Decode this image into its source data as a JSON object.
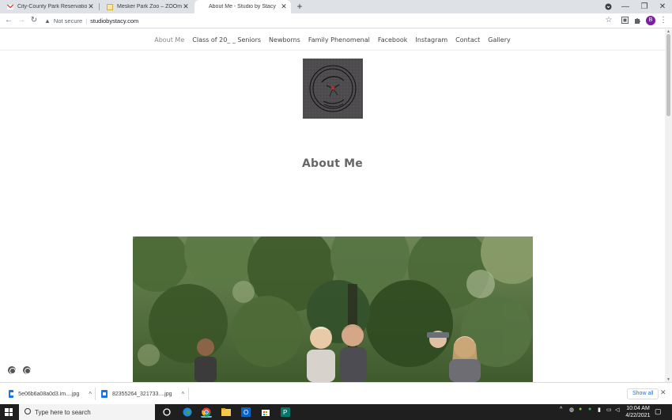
{
  "browser": {
    "tabs": [
      {
        "title": "City-County Park Reservations - E",
        "active": false,
        "favicon": "gmail-icon"
      },
      {
        "title": "Mesker Park Zoo – ZOOm a ZOO",
        "active": false,
        "favicon": "page-icon"
      },
      {
        "title": "About Me - Studio by Stacy",
        "active": true,
        "favicon": "none"
      }
    ],
    "address": {
      "security": "Not secure",
      "url": "studiobystacy.com"
    },
    "profile_initial": "B"
  },
  "site": {
    "nav": [
      {
        "label": "About Me",
        "active": true
      },
      {
        "label": "Class of 20_ _ Seniors",
        "active": false
      },
      {
        "label": "Newborns",
        "active": false
      },
      {
        "label": "Family Phenomenal",
        "active": false
      },
      {
        "label": "Facebook",
        "active": false
      },
      {
        "label": "Instagram",
        "active": false
      },
      {
        "label": "Contact",
        "active": false
      },
      {
        "label": "Gallery",
        "active": false
      }
    ],
    "page_title": "About Me"
  },
  "downloads": {
    "items": [
      {
        "name": "5e06b6a08a0d3.im....jpg"
      },
      {
        "name": "82355264_321733....jpg"
      }
    ],
    "show_all": "Show all"
  },
  "taskbar": {
    "search_placeholder": "Type here to search",
    "time": "10:04 AM",
    "date": "4/22/2021"
  },
  "colors": {
    "tabstrip": "#dee1e6",
    "taskbar": "#1f1f1f",
    "accent": "#1a73e8",
    "logo_bg": "#4e4c4e"
  }
}
